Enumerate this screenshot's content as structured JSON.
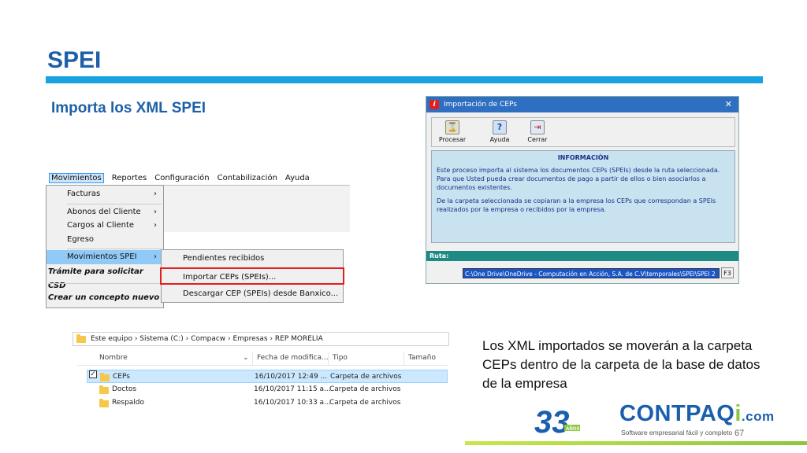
{
  "slide": {
    "title": "SPEI",
    "subtitle": "Importa los XML SPEI",
    "body": "Los XML importados se moverán a la carpeta CEPs dentro de la carpeta de la base de datos de la empresa",
    "page_number": "67",
    "accent_color": "#19a2e0"
  },
  "menu": {
    "bar": [
      "Movimientos",
      "Reportes",
      "Configuración",
      "Contabilización",
      "Ayuda"
    ],
    "items": {
      "facturas": "Facturas",
      "abonos": "Abonos del Cliente",
      "cargos": "Cargos al Cliente",
      "egreso": "Egreso",
      "movimientos_spei": "Movimientos SPEI",
      "tramite": "Trámite para solicitar CSD",
      "concepto": "Crear un concepto nuevo"
    },
    "arrow": "›",
    "submenu": {
      "pendientes": "Pendientes recibidos",
      "importar": "Importar CEPs (SPEIs)...",
      "descargar": "Descargar CEP (SPEIs) desde Banxico..."
    }
  },
  "explorer": {
    "breadcrumb": "Este equipo  ›  Sistema (C:)  ›  Compacw  ›  Empresas  ›  REP MORELIA",
    "columns": {
      "name": "Nombre",
      "date": "Fecha de modifica...",
      "type": "Tipo",
      "size": "Tamaño"
    },
    "rows": [
      {
        "name": "CEPs",
        "date": "16/10/2017 12:49 ...",
        "type": "Carpeta de archivos",
        "selected": true
      },
      {
        "name": "Doctos",
        "date": "16/10/2017 11:15 a...",
        "type": "Carpeta de archivos",
        "selected": false
      },
      {
        "name": "Respaldo",
        "date": "16/10/2017 10:33 a...",
        "type": "Carpeta de archivos",
        "selected": false
      }
    ]
  },
  "dialog": {
    "title": "Importación de CEPs",
    "close": "✕",
    "buttons": {
      "procesar": "Procesar",
      "ayuda": "Ayuda",
      "cerrar": "Cerrar"
    },
    "info_heading": "INFORMACIÓN",
    "info_p1": "Este proceso importa al sistema los documentos CEPs (SPEIs) desde la ruta seleccionada. Para que Usted pueda crear documentos de pago a partir de ellos o bien asociarlos a documentos existentes.",
    "info_p2": "De la carpeta seleccionada se copiaran a la empresa los CEPs que correspondan a SPEIs realizados por la empresa o recibidos por la empresa.",
    "ruta_label": "Ruta:",
    "ruta_value": "C:\\One Drive\\OneDrive - Computación en Acción, S.A. de C.V\\temporales\\SPEI\\SPEI 2",
    "f3": "F3"
  },
  "brand": {
    "name": "CONTPAQ",
    "i": "i",
    "com": ".com",
    "tagline": "Software empresarial fácil y completo",
    "anniversary": "33",
    "anniversary_sub": "AÑOS"
  }
}
